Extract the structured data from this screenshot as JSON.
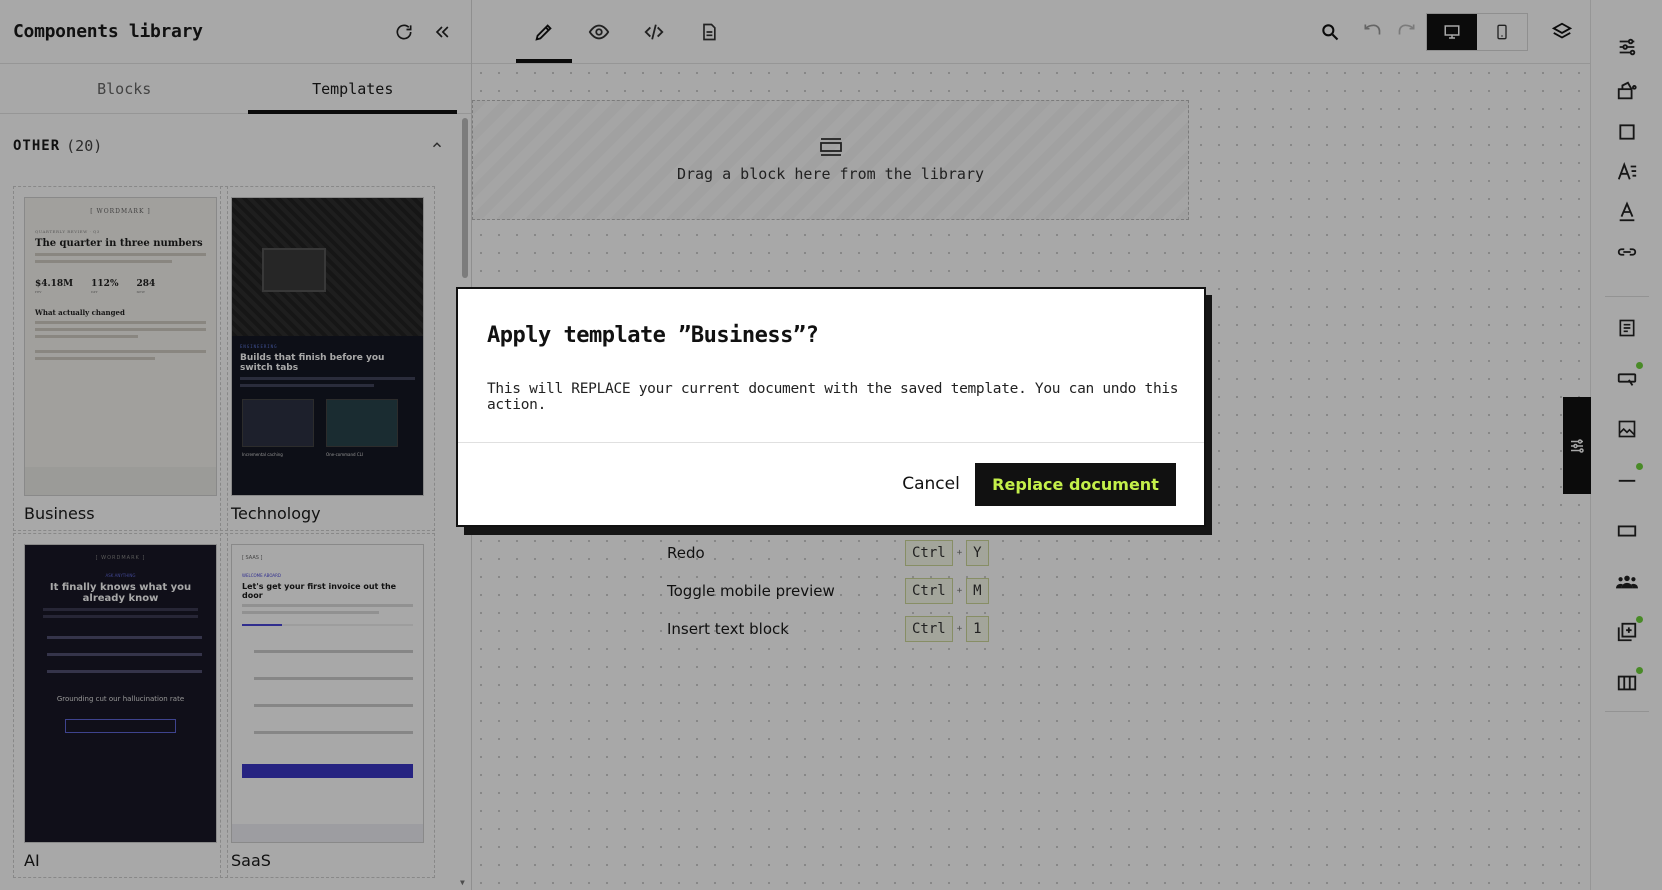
{
  "left_panel": {
    "title": "Components library",
    "tabs": [
      {
        "label": "Blocks",
        "active": false
      },
      {
        "label": "Templates",
        "active": true
      }
    ],
    "section": {
      "name": "OTHER",
      "count": "(20)"
    },
    "templates": [
      {
        "name": "Business"
      },
      {
        "name": "Technology"
      },
      {
        "name": "AI"
      },
      {
        "name": "SaaS"
      }
    ]
  },
  "toolbar": {
    "icons": [
      "pencil-icon",
      "eye-icon",
      "code-icon",
      "document-icon",
      "search-icon",
      "undo-icon",
      "redo-icon",
      "desktop-icon",
      "mobile-icon",
      "layers-icon"
    ],
    "active_mode": "edit",
    "active_device": "desktop"
  },
  "canvas": {
    "dropzone_text": "Drag a block here from the library",
    "shortcuts": [
      {
        "label": "Redo",
        "keys": [
          "Ctrl",
          "Y"
        ]
      },
      {
        "label": "Toggle mobile preview",
        "keys": [
          "Ctrl",
          "M"
        ]
      },
      {
        "label": "Insert text block",
        "keys": [
          "Ctrl",
          "1"
        ]
      }
    ]
  },
  "modal": {
    "title": "Apply template ”Business”?",
    "body": "This will REPLACE your current document with the saved template. You can undo this action.",
    "cancel_label": "Cancel",
    "confirm_label": "Replace document"
  },
  "colors": {
    "accent": "#c4f04a",
    "dark": "#111111",
    "status_dot": "#6fd23c"
  }
}
